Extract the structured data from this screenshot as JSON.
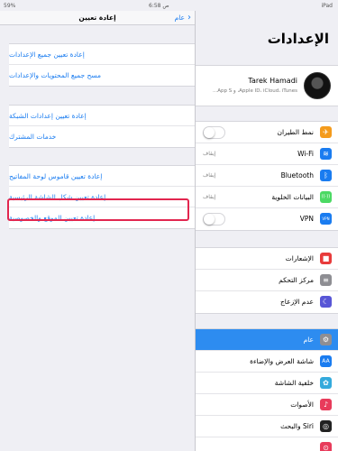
{
  "status_bar": {
    "battery": "59%",
    "time": "6:58 ص",
    "device": "iPad"
  },
  "detail": {
    "title": "إعادة تعيين",
    "back_label": "عام",
    "groups": [
      [
        "إعادة تعيين جميع الإعدادات",
        "مسح جميع المحتويات والإعدادات"
      ],
      [
        "إعادة تعيين إعدادات الشبكة",
        "خدمات المشترك"
      ],
      [
        "إعادة تعيين قاموس لوحة المفاتيح",
        "إعادة تعيين شكل الشاشة الرئيسية",
        "إعادة تعيين الموقع والخصوصية"
      ]
    ]
  },
  "master": {
    "title": "الإعدادات",
    "profile": {
      "name": "Tarek Hamadi",
      "subtitle": "Apple ID، iCloud، iTunes، و App S..."
    },
    "connectivity": [
      {
        "label": "نمط الطيران",
        "icon": "airplane-icon",
        "color": "#f49b1c",
        "glyph": "✈"
      },
      {
        "label": "Wi-Fi",
        "value": "إيقاف",
        "icon": "wifi-icon",
        "color": "#1a7cf0",
        "glyph": "≋"
      },
      {
        "label": "Bluetooth",
        "value": "إيقاف",
        "icon": "bluetooth-icon",
        "color": "#1a7cf0",
        "glyph": "ᛒ"
      },
      {
        "label": "البيانات الخلوية",
        "value": "إيقاف",
        "icon": "cellular-icon",
        "color": "#4cd964",
        "glyph": "((·))"
      },
      {
        "label": "VPN",
        "icon": "vpn-icon",
        "color": "#1a7cf0",
        "glyph": "VPN"
      }
    ],
    "system": [
      {
        "label": "الإشعارات",
        "icon": "notifications-icon",
        "color": "#e83b3b",
        "glyph": "■"
      },
      {
        "label": "مركز التحكم",
        "icon": "control-center-icon",
        "color": "#8e8e93",
        "glyph": "≡"
      },
      {
        "label": "عدم الإزعاج",
        "icon": "do-not-disturb-icon",
        "color": "#5856d6",
        "glyph": "☾"
      }
    ],
    "general": [
      {
        "label": "عام",
        "icon": "gear-icon",
        "color": "#8e8e93",
        "glyph": "⚙",
        "selected": true
      },
      {
        "label": "شاشة العرض والإضاءة",
        "icon": "display-icon",
        "color": "#1a7cf0",
        "glyph": "AA"
      },
      {
        "label": "خلفية الشاشة",
        "icon": "wallpaper-icon",
        "color": "#34aadc",
        "glyph": "✿"
      },
      {
        "label": "الأصوات",
        "icon": "sounds-icon",
        "color": "#e83b5b",
        "glyph": "♪"
      },
      {
        "label": "Siri والبحث",
        "icon": "siri-icon",
        "color": "#222",
        "glyph": "◎"
      },
      {
        "label": "",
        "icon": "touch-id-icon",
        "color": "#e83b5b",
        "glyph": "⊙"
      }
    ]
  }
}
